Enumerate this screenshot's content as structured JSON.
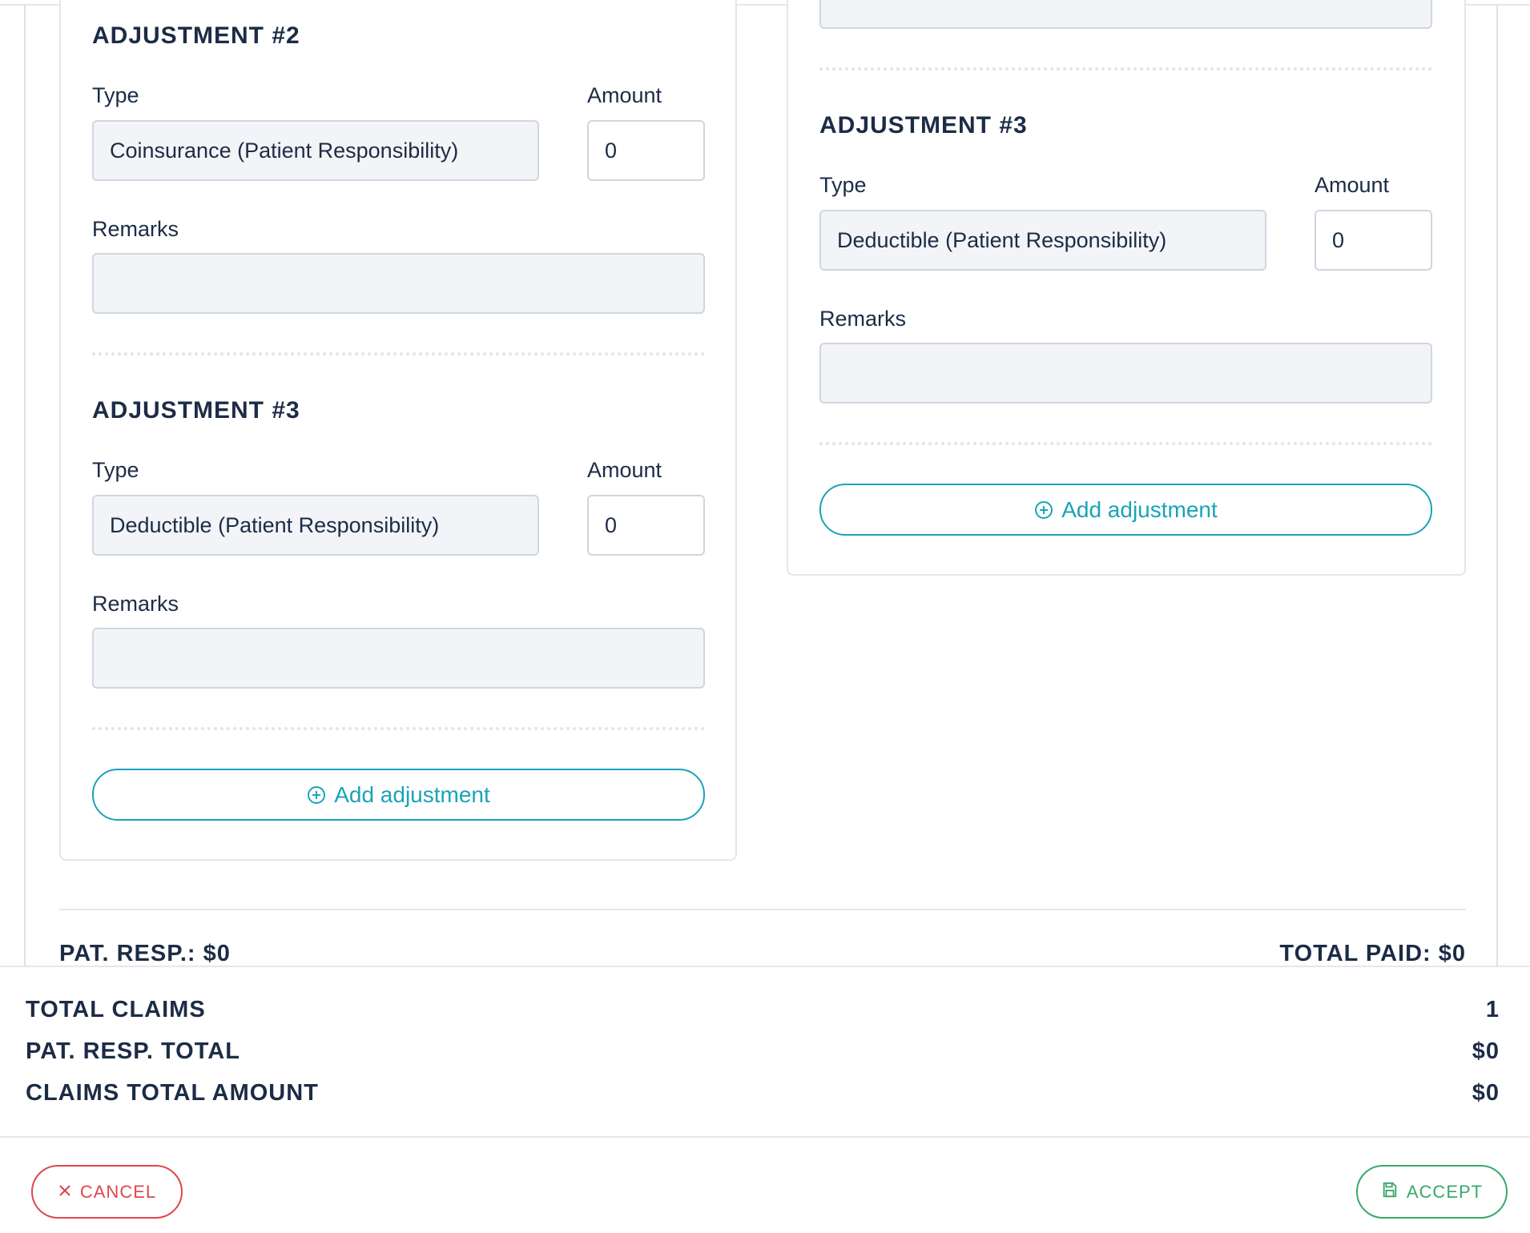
{
  "left_card": {
    "adjustment_2": {
      "heading": "ADJUSTMENT #2",
      "type_label": "Type",
      "amount_label": "Amount",
      "type_value": "Coinsurance (Patient Responsibility)",
      "amount_value": "0",
      "remarks_label": "Remarks",
      "remarks_value": ""
    },
    "adjustment_3": {
      "heading": "ADJUSTMENT #3",
      "type_label": "Type",
      "amount_label": "Amount",
      "type_value": "Deductible (Patient Responsibility)",
      "amount_value": "0",
      "remarks_label": "Remarks",
      "remarks_value": ""
    },
    "add_adjustment_label": "Add adjustment"
  },
  "right_card": {
    "adjustment_3": {
      "heading": "ADJUSTMENT #3",
      "type_label": "Type",
      "amount_label": "Amount",
      "type_value": "Deductible (Patient Responsibility)",
      "amount_value": "0",
      "remarks_label": "Remarks",
      "remarks_value": ""
    },
    "add_adjustment_label": "Add adjustment"
  },
  "claim_footer": {
    "pat_resp": "PAT. RESP.: $0",
    "total_paid": "TOTAL PAID: $0"
  },
  "summary": {
    "total_claims_label": "TOTAL CLAIMS",
    "total_claims_value": "1",
    "pat_resp_total_label": "PAT. RESP. TOTAL",
    "pat_resp_total_value": "$0",
    "claims_total_amount_label": "CLAIMS TOTAL AMOUNT",
    "claims_total_amount_value": "$0"
  },
  "actions": {
    "cancel_label": "CANCEL",
    "accept_label": "ACCEPT"
  },
  "icons": {
    "add": "plus-circle-icon",
    "cancel": "close-icon",
    "accept": "save-icon"
  },
  "colors": {
    "accent": "#1aa3b8",
    "cancel": "#e0474c",
    "accept": "#3aa86a",
    "text": "#1c2c46"
  }
}
